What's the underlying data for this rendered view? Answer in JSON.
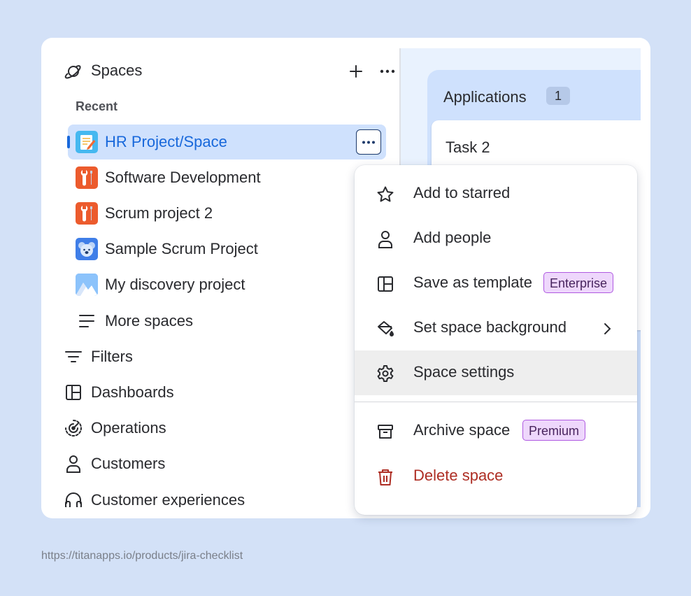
{
  "sidebar": {
    "header": {
      "title": "Spaces"
    },
    "recent_label": "Recent",
    "projects": [
      {
        "name": "HR Project/Space",
        "selected": true,
        "icon": "notepad-pencil-icon"
      },
      {
        "name": "Software Development",
        "icon": "wrench-screwdriver-icon"
      },
      {
        "name": "Scrum project 2",
        "icon": "wrench-screwdriver-icon"
      },
      {
        "name": "Sample Scrum Project",
        "icon": "koala-icon"
      },
      {
        "name": "My discovery project",
        "icon": "mountain-icon"
      }
    ],
    "more_spaces": "More spaces",
    "nav": [
      {
        "label": "Filters",
        "icon": "filter-icon"
      },
      {
        "label": "Dashboards",
        "icon": "dashboard-icon"
      },
      {
        "label": "Operations",
        "icon": "operations-icon"
      },
      {
        "label": "Customers",
        "icon": "person-icon"
      },
      {
        "label": "Customer experiences",
        "icon": "headphones-icon"
      }
    ]
  },
  "board": {
    "column_title": "Applications",
    "column_count": "1",
    "task_title": "Task 2"
  },
  "menu": {
    "items": [
      {
        "label": "Add to starred",
        "icon": "star-icon"
      },
      {
        "label": "Add people",
        "icon": "person-icon"
      },
      {
        "label": "Save as template",
        "icon": "template-icon",
        "badge": "Enterprise"
      },
      {
        "label": "Set space background",
        "icon": "paint-bucket-icon",
        "has_submenu": true
      },
      {
        "label": "Space settings",
        "icon": "gear-icon",
        "hovered": true
      },
      {
        "label": "Archive space",
        "icon": "archive-icon",
        "badge": "Premium"
      },
      {
        "label": "Delete space",
        "icon": "trash-icon",
        "danger": true
      }
    ]
  },
  "footer": {
    "url": "https://titanapps.io/products/jira-checklist"
  },
  "colors": {
    "background": "#d3e1f7",
    "selected": "#cfe1fd",
    "accent": "#1868db",
    "danger": "#ae2e24",
    "lozenge": "#eed7fc"
  }
}
